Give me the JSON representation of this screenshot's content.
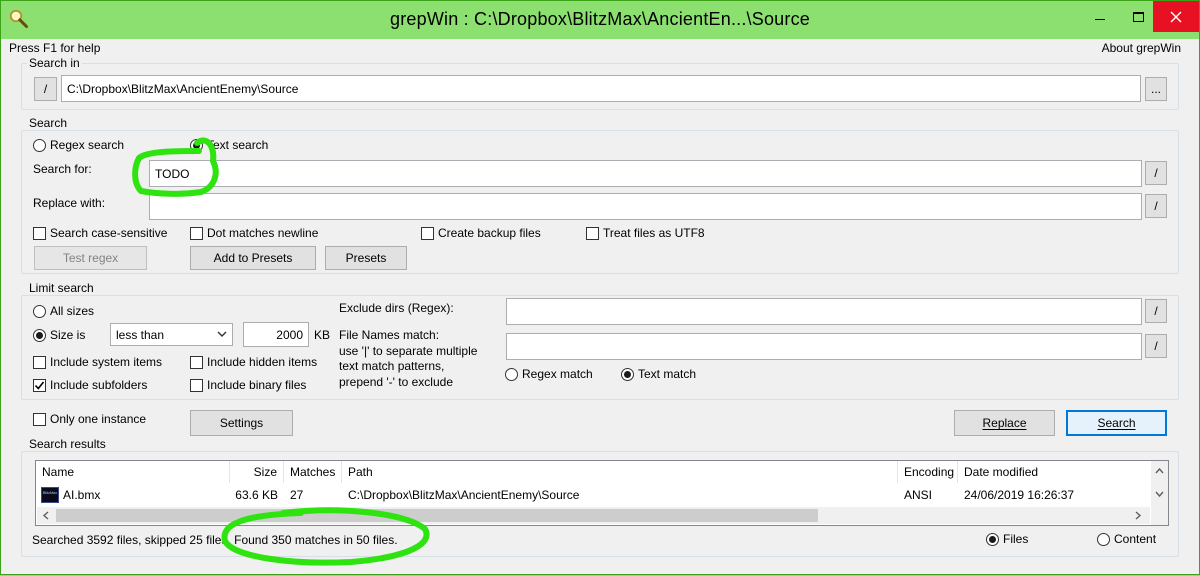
{
  "window": {
    "title": "grepWin : C:\\Dropbox\\BlitzMax\\AncientEn...\\Source"
  },
  "menu": {
    "help": "Press F1 for help",
    "about": "About grepWin"
  },
  "search_in": {
    "group_label": "Search in",
    "slash_label": "/",
    "path": "C:\\Dropbox\\BlitzMax\\AncientEnemy\\Source",
    "browse_label": "..."
  },
  "search": {
    "group_label": "Search",
    "regex_label": "Regex search",
    "text_label": "Text search",
    "mode": "text",
    "search_for_label": "Search for:",
    "search_for_value": "TODO",
    "replace_with_label": "Replace with:",
    "replace_with_value": "",
    "slash_label": "/",
    "case_sensitive_label": "Search case-sensitive",
    "case_sensitive": false,
    "dot_newline_label": "Dot matches newline",
    "dot_newline": false,
    "backup_label": "Create backup files",
    "backup": false,
    "utf8_label": "Treat files as UTF8",
    "utf8": false,
    "test_regex_label": "Test regex",
    "add_presets_label": "Add to Presets",
    "presets_label": "Presets"
  },
  "limit": {
    "group_label": "Limit search",
    "all_sizes_label": "All sizes",
    "size_is_label": "Size is",
    "size_mode": "size_is",
    "size_op": "less than",
    "size_value": "2000",
    "size_unit": "KB",
    "system_items_label": "Include system items",
    "system_items": false,
    "hidden_items_label": "Include hidden items",
    "hidden_items": false,
    "subfolders_label": "Include subfolders",
    "subfolders": true,
    "binary_files_label": "Include binary files",
    "binary_files": false,
    "exclude_dirs_label": "Exclude dirs (Regex):",
    "exclude_dirs_value": "",
    "file_names_lines": [
      "File Names match:",
      "use '|' to separate multiple",
      "text match patterns,",
      "prepend '-' to exclude"
    ],
    "file_names_value": "",
    "regex_match_label": "Regex match",
    "text_match_label": "Text match",
    "match_mode": "text",
    "slash_label": "/"
  },
  "actions": {
    "only_one_instance_label": "Only one instance",
    "only_one_instance": false,
    "settings_label": "Settings",
    "replace_label": "Replace",
    "search_label": "Search"
  },
  "results": {
    "group_label": "Search results",
    "columns": [
      "Name",
      "Size",
      "Matches",
      "Path",
      "Encoding",
      "Date modified"
    ],
    "rows": [
      {
        "name": "AI.bmx",
        "size": "63.6 KB",
        "matches": "27",
        "path": "C:\\Dropbox\\BlitzMax\\AncientEnemy\\Source",
        "encoding": "ANSI",
        "date_modified": "24/06/2019 16:26:37"
      }
    ],
    "file_icon_text": "BlitzMax"
  },
  "status": {
    "text": "Searched 3592 files, skipped 25 files. Found 350 matches in 50 files.",
    "files_label": "Files",
    "content_label": "Content",
    "view_mode": "files"
  },
  "colors": {
    "highlight": "#2ee310",
    "title_bar": "#8ce06f",
    "window_bg": "#f0f0f0",
    "close_button": "#e81123"
  }
}
